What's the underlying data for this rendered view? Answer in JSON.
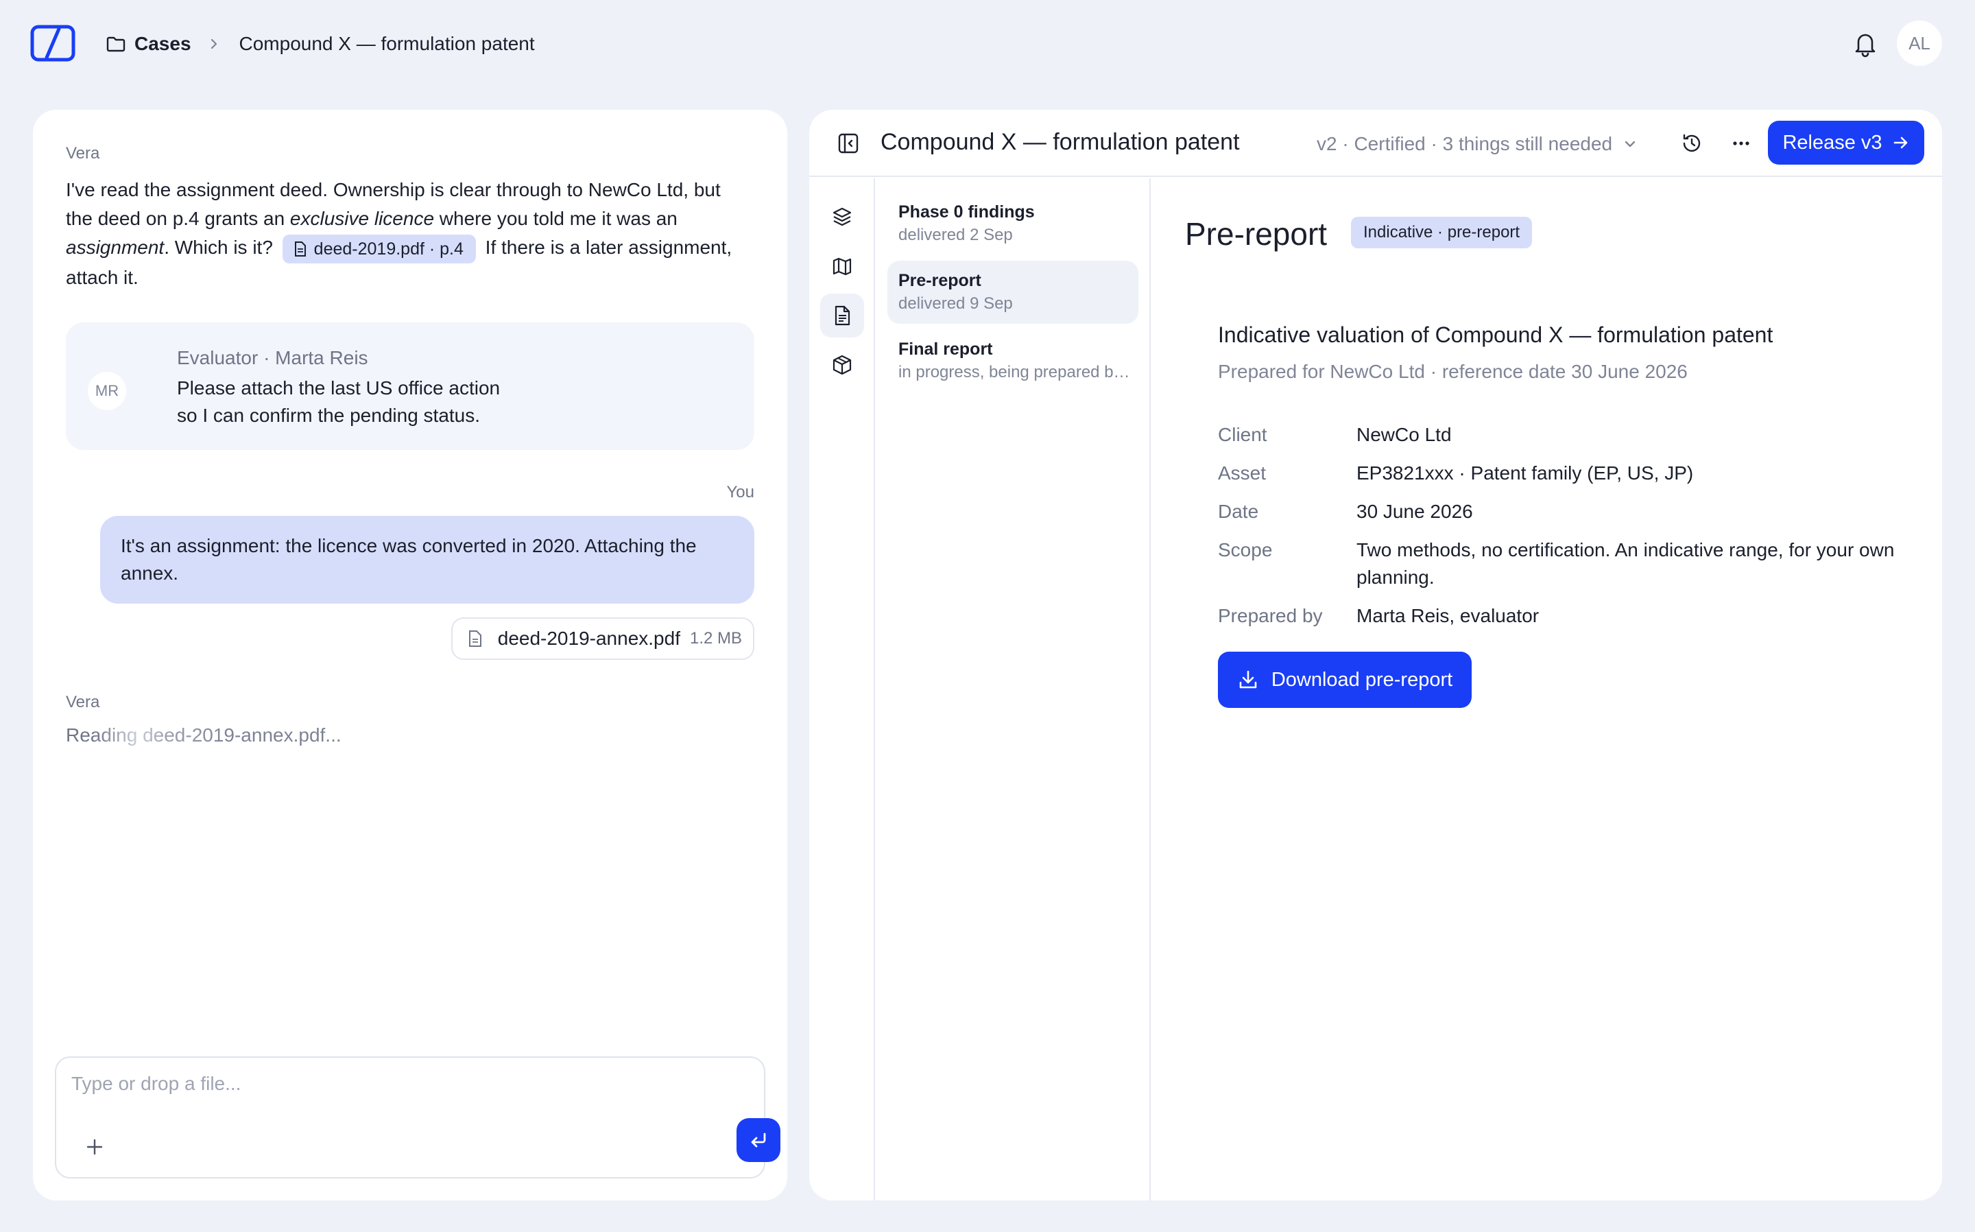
{
  "breadcrumb": {
    "root": "Cases",
    "current": "Compound X — formulation patent"
  },
  "user": {
    "initials": "AL"
  },
  "chat": {
    "messages": [
      {
        "author": "Vera",
        "segments": {
          "t1": "I've read the assignment deed. Ownership is clear through to NewCo Ltd, but the deed on p.4 grants an ",
          "em1": "exclusive licence",
          "t2": " where you told me it was an ",
          "em2": "assignment",
          "t3": ". Which is it? ",
          "chip": "deed-2019.pdf · p.4",
          "t4": " If there is a later assignment, attach it."
        }
      }
    ],
    "evaluator": {
      "initials": "MR",
      "name": "Evaluator · Marta Reis",
      "line1": "Please attach the last US office action",
      "line2": "so I can confirm the pending status."
    },
    "you": {
      "label": "You",
      "text": "It's an assignment: the licence was converted in 2020. Attaching the annex.",
      "attachment_name": "deed-2019-annex.pdf",
      "attachment_size": "1.2 MB"
    },
    "vera_status": {
      "author": "Vera",
      "text": "Reading deed-2019-annex.pdf..."
    },
    "composer": {
      "placeholder": "Type or drop a file..."
    }
  },
  "document": {
    "title": "Compound X — formulation patent",
    "version": "v2 · Certified · 3 things still needed",
    "release_label": "Release v3",
    "sections": [
      {
        "title": "Phase 0 findings",
        "sub": "delivered 2 Sep"
      },
      {
        "title": "Pre-report",
        "sub": "delivered 9 Sep"
      },
      {
        "title": "Final report",
        "sub": "in progress, being prepared by Marta Reis"
      }
    ],
    "content": {
      "heading": "Pre-report",
      "badge": "Indicative · pre-report",
      "valuation_title": "Indicative valuation of Compound X — formulation patent",
      "valuation_sub": "Prepared for NewCo Ltd · reference date 30 June 2026",
      "fields": [
        {
          "key": "Client",
          "value": "NewCo Ltd"
        },
        {
          "key": "Asset",
          "value": "EP3821xxx · Patent family (EP, US, JP)"
        },
        {
          "key": "Date",
          "value": "30 June 2026"
        },
        {
          "key": "Scope",
          "value": "Two methods, no certification. An indicative range, for your own planning."
        },
        {
          "key": "Prepared by",
          "value": "Marta Reis, evaluator"
        }
      ],
      "download_label": "Download pre-report"
    }
  },
  "colors": {
    "accent": "#1a3ef5",
    "chip_bg": "#d6ddfb",
    "page_bg": "#eef1f8",
    "muted_text": "#7f8596"
  }
}
